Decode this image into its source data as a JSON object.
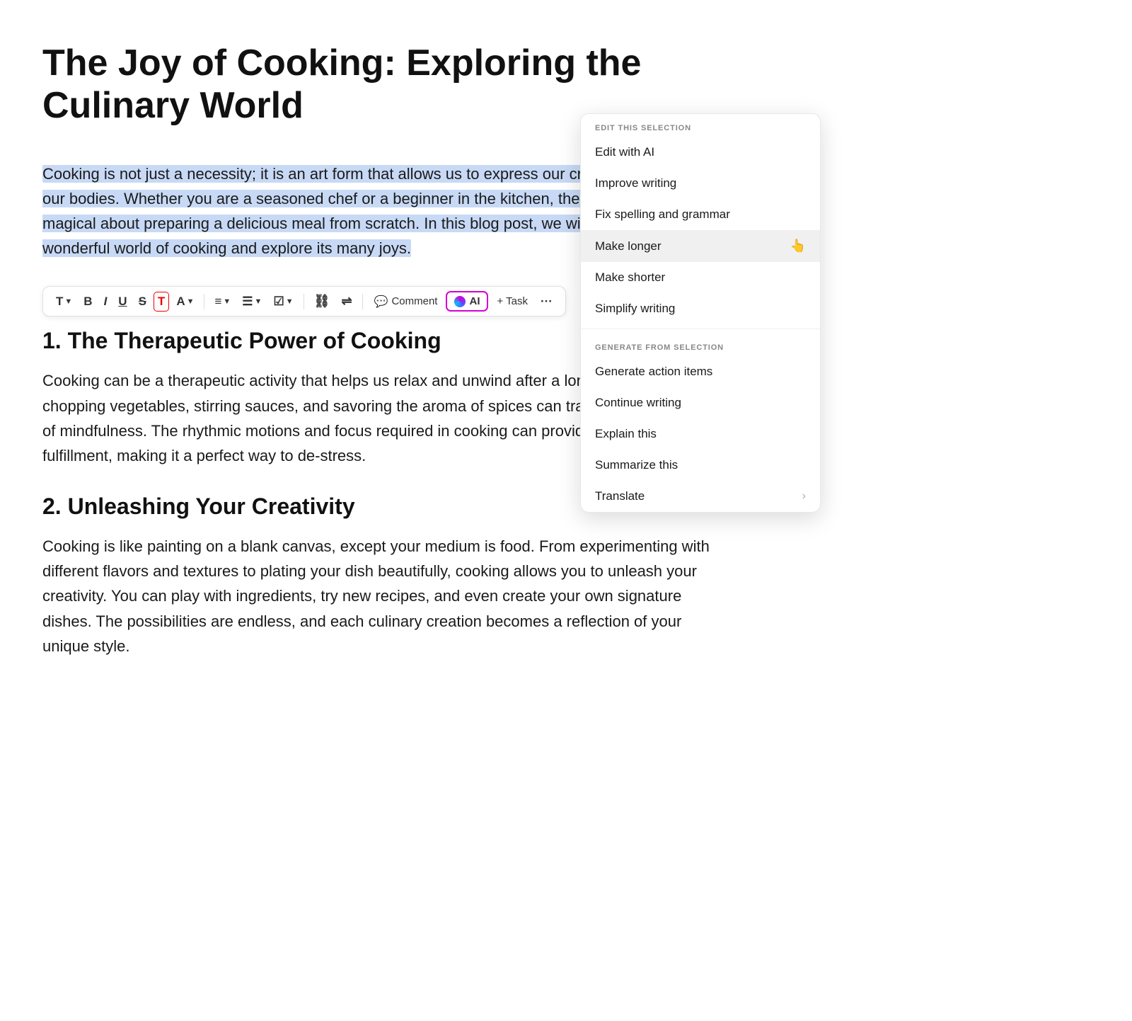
{
  "document": {
    "title": "The Joy of Cooking: Exploring the Culinary World",
    "selected_paragraph": "Cooking is not just a necessity; it is an art form that allows us to express our creativity and nourish our bodies. Whether you are a seasoned chef or a beginner in the kitchen, there is something magical about preparing a delicious meal from scratch. In this blog post, we will delve into the wonderful world of cooking and explore its many joys.",
    "section1_heading": "1. The Therapeutic Power of Cooking",
    "section1_body": "Cooking can be a therapeutic activity that helps us relax and unwind after a long day. The act of chopping vegetables, stirring sauces, and savoring the aroma of spices can transport us to a state of mindfulness. The rhythmic motions and focus required in cooking can provide a sense of fulfillment, making it a perfect way to de-stress.",
    "section2_heading": "2. Unleashing Your Creativity",
    "section2_body": "Cooking is like painting on a blank canvas, except your medium is food. From experimenting with different flavors and textures to plating your dish beautifully, cooking allows you to unleash your creativity. You can play with ingredients, try new recipes, and even create your own signature dishes. The possibilities are endless, and each culinary creation becomes a reflection of your unique style."
  },
  "toolbar": {
    "text_btn": "T",
    "bold_btn": "B",
    "italic_btn": "I",
    "underline_btn": "U",
    "strikethrough_btn": "S",
    "highlight_btn": "T",
    "text_color_btn": "A",
    "align_btn": "≡",
    "list_btn": "☰",
    "checklist_btn": "☑",
    "link_btn": "🔗",
    "indent_btn": "⇥",
    "comment_label": "Comment",
    "ai_label": "AI",
    "task_label": "+ Task",
    "more_btn": "···"
  },
  "ai_dropdown": {
    "edit_section_label": "EDIT THIS SELECTION",
    "edit_with_ai": "Edit with AI",
    "improve_writing": "Improve writing",
    "fix_spelling": "Fix spelling and grammar",
    "make_longer": "Make longer",
    "make_shorter": "Make shorter",
    "simplify_writing": "Simplify writing",
    "generate_section_label": "GENERATE FROM SELECTION",
    "generate_action_items": "Generate action items",
    "continue_writing": "Continue writing",
    "explain_this": "Explain this",
    "summarize_this": "Summarize this",
    "translate": "Translate"
  }
}
